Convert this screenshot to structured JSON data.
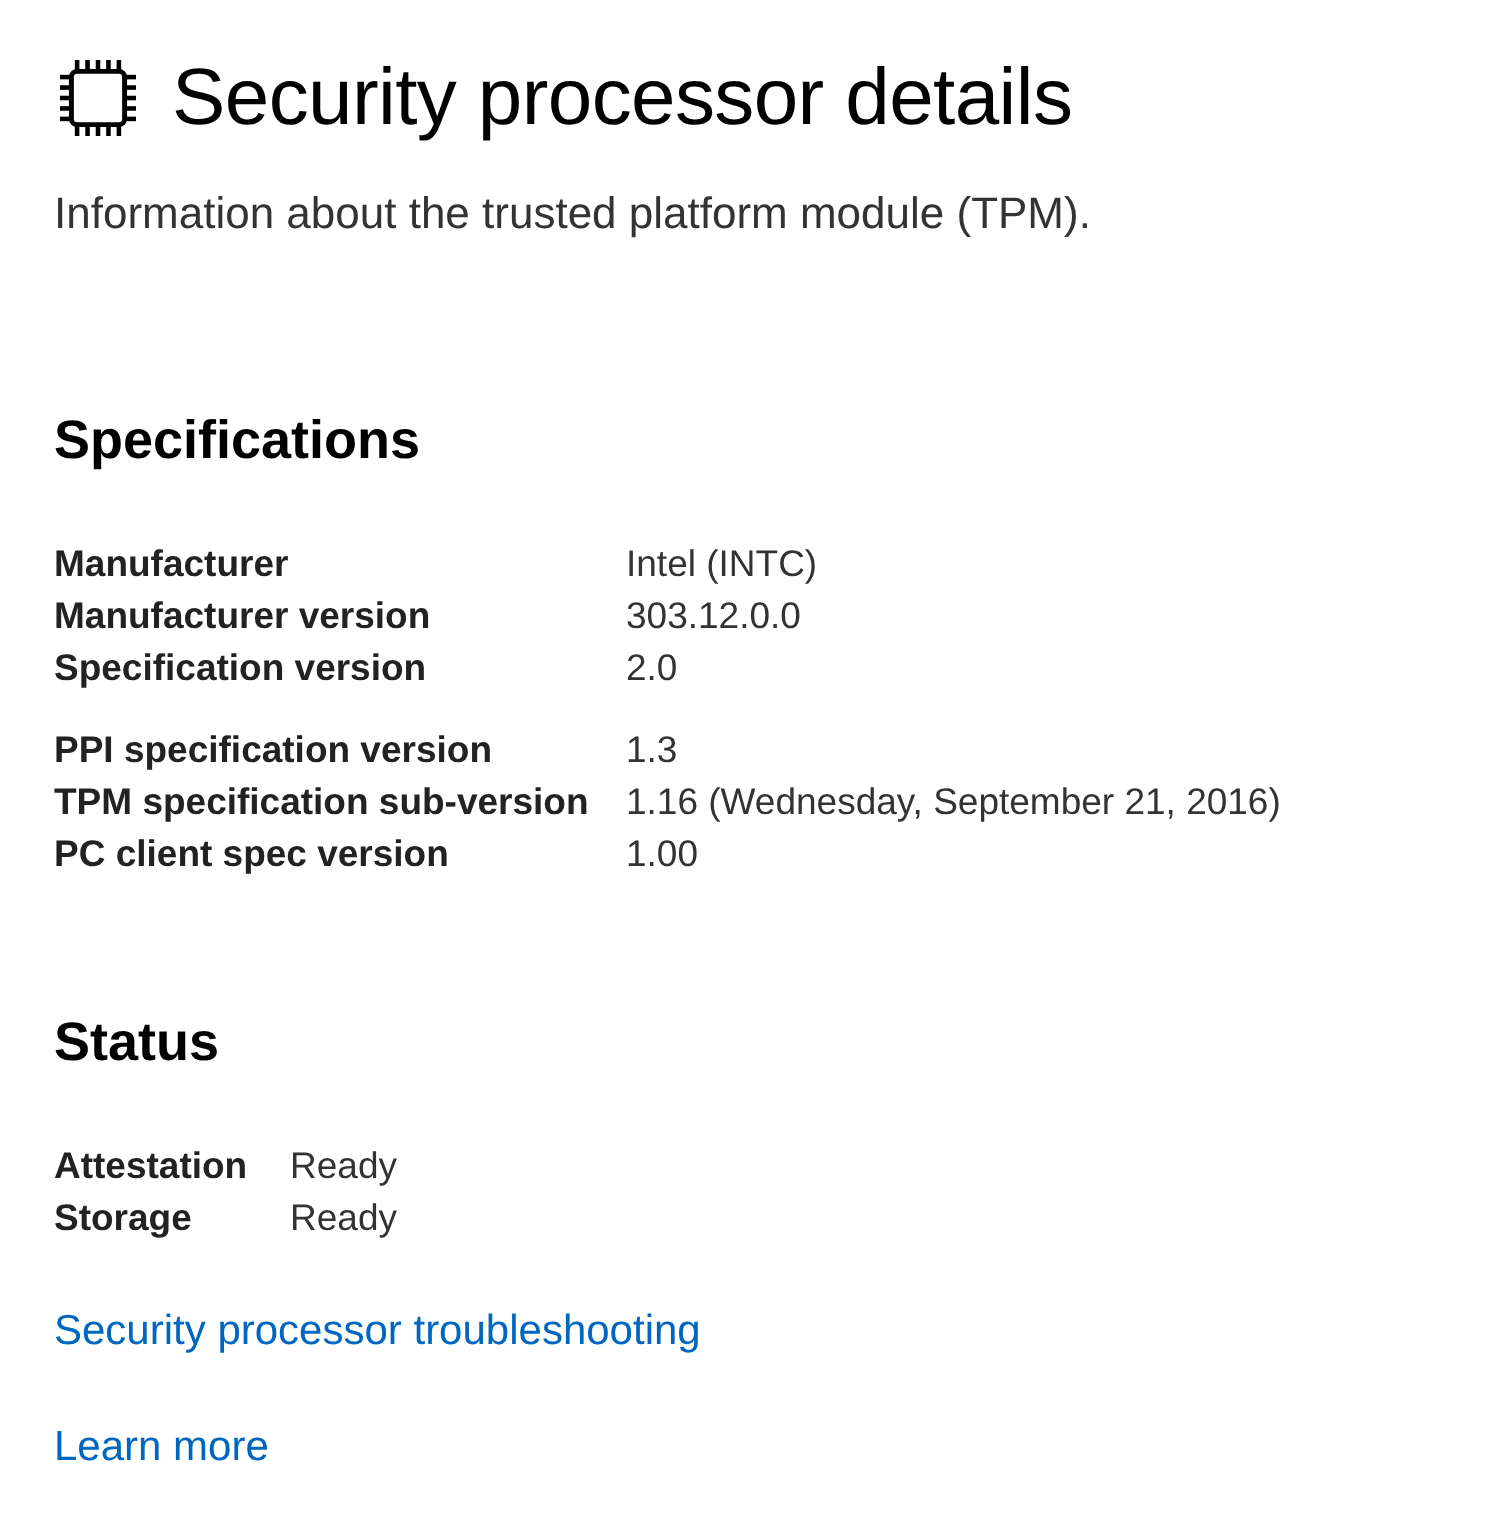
{
  "header": {
    "title": "Security processor details",
    "description": "Information about the trusted platform module (TPM)."
  },
  "specifications": {
    "heading": "Specifications",
    "groups": [
      [
        {
          "label": "Manufacturer",
          "value": "Intel (INTC)"
        },
        {
          "label": "Manufacturer version",
          "value": "303.12.0.0"
        },
        {
          "label": "Specification version",
          "value": "2.0"
        }
      ],
      [
        {
          "label": "PPI specification version",
          "value": "1.3"
        },
        {
          "label": "TPM specification sub-version",
          "value": "1.16 (Wednesday, September 21, 2016)"
        },
        {
          "label": "PC client spec version",
          "value": "1.00"
        }
      ]
    ]
  },
  "status": {
    "heading": "Status",
    "rows": [
      {
        "label": "Attestation",
        "value": "Ready"
      },
      {
        "label": "Storage",
        "value": "Ready"
      }
    ]
  },
  "links": [
    "Security processor troubleshooting",
    "Learn more"
  ]
}
